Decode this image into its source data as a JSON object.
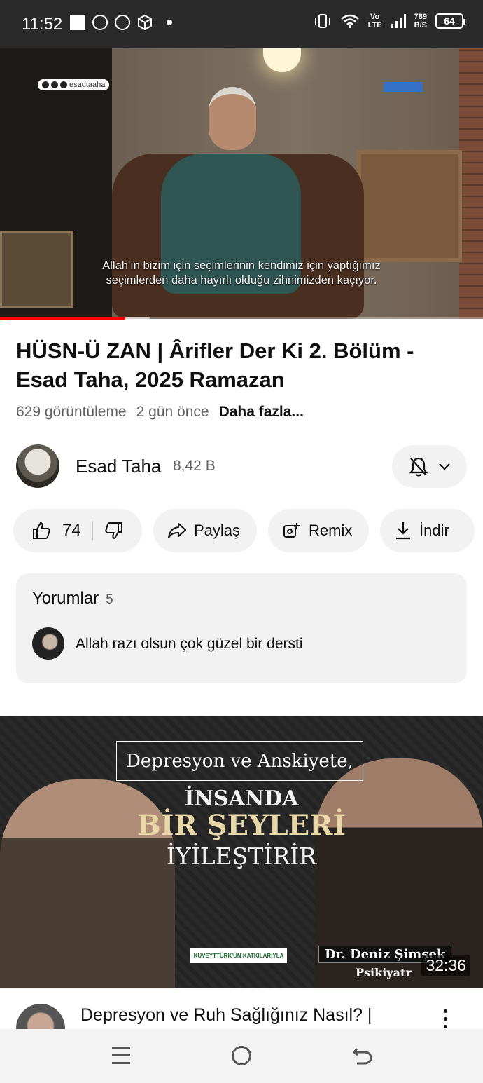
{
  "status_bar": {
    "time": "11:52",
    "net_speed_value": "789",
    "net_speed_unit": "B/S",
    "network_top": "Vo",
    "network_bottom": "LTE",
    "battery": "64"
  },
  "player": {
    "channel_handle": "esadtaaha",
    "subtitle_line1": "Allah'ın bizim için seçimlerinin kendimiz için yaptığımız",
    "subtitle_line2": "seçimlerden daha hayırlı olduğu zihnimizden kaçıyor.",
    "progress_fraction": 0.26,
    "buffer_fraction": 0.31
  },
  "video": {
    "title": "HÜSN-Ü ZAN | Ârifler Der Ki 2. Bölüm - Esad Taha, 2025 Ramazan",
    "views": "629 görüntüleme",
    "age": "2 gün önce",
    "more_label": "Daha fazla..."
  },
  "channel": {
    "name": "Esad Taha",
    "subscribers": "8,42 B"
  },
  "actions": {
    "like_count": "74",
    "share_label": "Paylaş",
    "remix_label": "Remix",
    "download_label": "İndir"
  },
  "comments": {
    "title": "Yorumlar",
    "count": "5",
    "top_comment": "Allah razı olsun çok güzel bir dersti"
  },
  "next_video": {
    "thumb_box_text": "Depresyon ve Anskiyete,",
    "thumb_line1": "İNSANDA",
    "thumb_line2": "BİR ŞEYLERİ",
    "thumb_line3": "İYİLEŞTİRİR",
    "sponsor_text": "KUVEYTTÜRK'ÜN KATKILARIYLA",
    "guest_name": "Dr. Deniz Şimşek",
    "guest_title": "Psikiyatr",
    "duration": "32:36",
    "title": "Depresyon ve Ruh Sağlığınız Nasıl? |"
  },
  "colors": {
    "progress": "#ff0000",
    "pill_bg": "#f2f2f2",
    "secondary_text": "#606060"
  }
}
